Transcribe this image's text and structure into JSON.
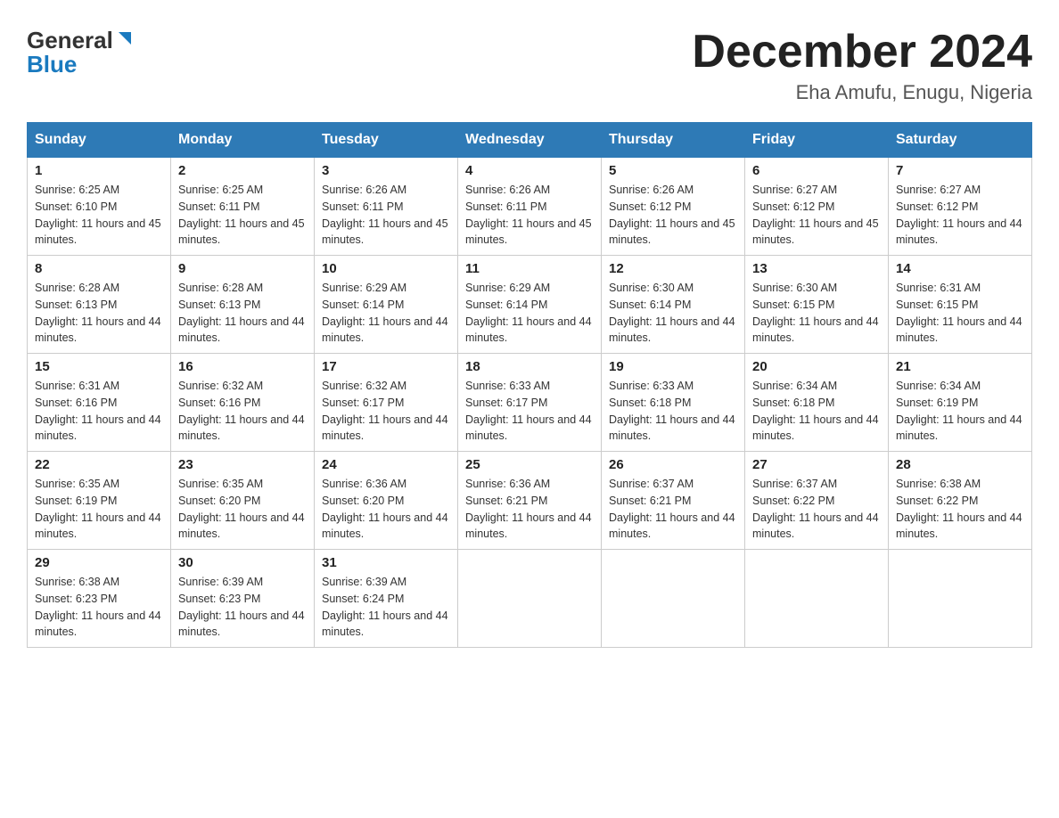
{
  "header": {
    "title": "December 2024",
    "subtitle": "Eha Amufu, Enugu, Nigeria"
  },
  "logo": {
    "line1": "General",
    "line2": "Blue"
  },
  "days_header": [
    "Sunday",
    "Monday",
    "Tuesday",
    "Wednesday",
    "Thursday",
    "Friday",
    "Saturday"
  ],
  "weeks": [
    [
      {
        "day": "1",
        "sunrise": "6:25 AM",
        "sunset": "6:10 PM",
        "daylight": "11 hours and 45 minutes."
      },
      {
        "day": "2",
        "sunrise": "6:25 AM",
        "sunset": "6:11 PM",
        "daylight": "11 hours and 45 minutes."
      },
      {
        "day": "3",
        "sunrise": "6:26 AM",
        "sunset": "6:11 PM",
        "daylight": "11 hours and 45 minutes."
      },
      {
        "day": "4",
        "sunrise": "6:26 AM",
        "sunset": "6:11 PM",
        "daylight": "11 hours and 45 minutes."
      },
      {
        "day": "5",
        "sunrise": "6:26 AM",
        "sunset": "6:12 PM",
        "daylight": "11 hours and 45 minutes."
      },
      {
        "day": "6",
        "sunrise": "6:27 AM",
        "sunset": "6:12 PM",
        "daylight": "11 hours and 45 minutes."
      },
      {
        "day": "7",
        "sunrise": "6:27 AM",
        "sunset": "6:12 PM",
        "daylight": "11 hours and 44 minutes."
      }
    ],
    [
      {
        "day": "8",
        "sunrise": "6:28 AM",
        "sunset": "6:13 PM",
        "daylight": "11 hours and 44 minutes."
      },
      {
        "day": "9",
        "sunrise": "6:28 AM",
        "sunset": "6:13 PM",
        "daylight": "11 hours and 44 minutes."
      },
      {
        "day": "10",
        "sunrise": "6:29 AM",
        "sunset": "6:14 PM",
        "daylight": "11 hours and 44 minutes."
      },
      {
        "day": "11",
        "sunrise": "6:29 AM",
        "sunset": "6:14 PM",
        "daylight": "11 hours and 44 minutes."
      },
      {
        "day": "12",
        "sunrise": "6:30 AM",
        "sunset": "6:14 PM",
        "daylight": "11 hours and 44 minutes."
      },
      {
        "day": "13",
        "sunrise": "6:30 AM",
        "sunset": "6:15 PM",
        "daylight": "11 hours and 44 minutes."
      },
      {
        "day": "14",
        "sunrise": "6:31 AM",
        "sunset": "6:15 PM",
        "daylight": "11 hours and 44 minutes."
      }
    ],
    [
      {
        "day": "15",
        "sunrise": "6:31 AM",
        "sunset": "6:16 PM",
        "daylight": "11 hours and 44 minutes."
      },
      {
        "day": "16",
        "sunrise": "6:32 AM",
        "sunset": "6:16 PM",
        "daylight": "11 hours and 44 minutes."
      },
      {
        "day": "17",
        "sunrise": "6:32 AM",
        "sunset": "6:17 PM",
        "daylight": "11 hours and 44 minutes."
      },
      {
        "day": "18",
        "sunrise": "6:33 AM",
        "sunset": "6:17 PM",
        "daylight": "11 hours and 44 minutes."
      },
      {
        "day": "19",
        "sunrise": "6:33 AM",
        "sunset": "6:18 PM",
        "daylight": "11 hours and 44 minutes."
      },
      {
        "day": "20",
        "sunrise": "6:34 AM",
        "sunset": "6:18 PM",
        "daylight": "11 hours and 44 minutes."
      },
      {
        "day": "21",
        "sunrise": "6:34 AM",
        "sunset": "6:19 PM",
        "daylight": "11 hours and 44 minutes."
      }
    ],
    [
      {
        "day": "22",
        "sunrise": "6:35 AM",
        "sunset": "6:19 PM",
        "daylight": "11 hours and 44 minutes."
      },
      {
        "day": "23",
        "sunrise": "6:35 AM",
        "sunset": "6:20 PM",
        "daylight": "11 hours and 44 minutes."
      },
      {
        "day": "24",
        "sunrise": "6:36 AM",
        "sunset": "6:20 PM",
        "daylight": "11 hours and 44 minutes."
      },
      {
        "day": "25",
        "sunrise": "6:36 AM",
        "sunset": "6:21 PM",
        "daylight": "11 hours and 44 minutes."
      },
      {
        "day": "26",
        "sunrise": "6:37 AM",
        "sunset": "6:21 PM",
        "daylight": "11 hours and 44 minutes."
      },
      {
        "day": "27",
        "sunrise": "6:37 AM",
        "sunset": "6:22 PM",
        "daylight": "11 hours and 44 minutes."
      },
      {
        "day": "28",
        "sunrise": "6:38 AM",
        "sunset": "6:22 PM",
        "daylight": "11 hours and 44 minutes."
      }
    ],
    [
      {
        "day": "29",
        "sunrise": "6:38 AM",
        "sunset": "6:23 PM",
        "daylight": "11 hours and 44 minutes."
      },
      {
        "day": "30",
        "sunrise": "6:39 AM",
        "sunset": "6:23 PM",
        "daylight": "11 hours and 44 minutes."
      },
      {
        "day": "31",
        "sunrise": "6:39 AM",
        "sunset": "6:24 PM",
        "daylight": "11 hours and 44 minutes."
      },
      null,
      null,
      null,
      null
    ]
  ]
}
